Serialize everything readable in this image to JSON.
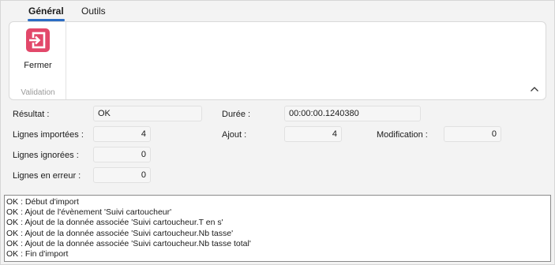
{
  "tabs": [
    {
      "label": "Général",
      "active": true
    },
    {
      "label": "Outils",
      "active": false
    }
  ],
  "ribbon": {
    "close_label": "Fermer",
    "group_label": "Validation",
    "close_icon": "exit-arrow-icon",
    "collapse_icon": "chevron-up-icon",
    "accent_color": "#e2486a"
  },
  "fields": {
    "resultat": {
      "label": "Résultat :",
      "value": "OK"
    },
    "duree": {
      "label": "Durée :",
      "value": "00:00:00.1240380"
    },
    "lignes_importees": {
      "label": "Lignes importées :",
      "value": "4"
    },
    "ajout": {
      "label": "Ajout :",
      "value": "4"
    },
    "modification": {
      "label": "Modification :",
      "value": "0"
    },
    "lignes_ignorees": {
      "label": "Lignes ignorées :",
      "value": "0"
    },
    "lignes_erreur": {
      "label": "Lignes en erreur :",
      "value": "0"
    }
  },
  "log": [
    "OK : Début d'import",
    "OK : Ajout de l'évènement 'Suivi cartoucheur'",
    "OK : Ajout de la donnée associée 'Suivi cartoucheur.T en s'",
    "OK : Ajout de la donnée associée 'Suivi cartoucheur.Nb tasse'",
    "OK : Ajout de la donnée associée 'Suivi cartoucheur.Nb tasse total'",
    "OK : Fin d'import"
  ]
}
